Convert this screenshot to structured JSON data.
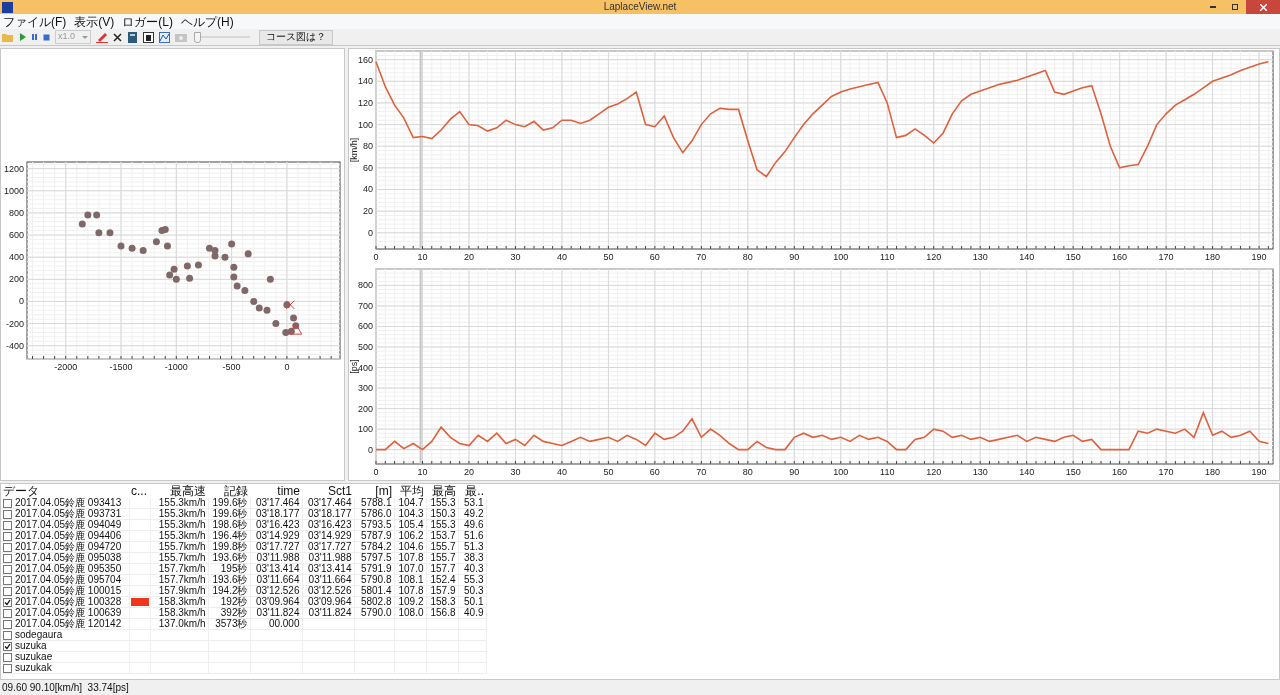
{
  "window": {
    "title": "LaplaceView.net"
  },
  "menu": [
    "ファイル(F)",
    "表示(V)",
    "ロガー(L)",
    "ヘルプ(H)"
  ],
  "toolbar": {
    "speed_select": {
      "value": "x1.0",
      "disabled": true
    },
    "camera_disabled": true,
    "slider": {
      "level": 0
    },
    "course_button": "コース図は？"
  },
  "track_map": {
    "chart_data": {
      "type": "scatter",
      "grid": true,
      "xlim": [
        -2350,
        480
      ],
      "ylim": [
        -520,
        1260
      ],
      "xticks": [
        -2000,
        -1500,
        -1000,
        -500,
        0
      ],
      "yticks": [
        -400,
        -200,
        0,
        200,
        400,
        600,
        800,
        1000,
        1200
      ],
      "x": [
        -1850,
        -1800,
        -1720,
        -1700,
        -1600,
        -1500,
        -1400,
        -1300,
        -1180,
        -1130,
        -1100,
        -1080,
        -1060,
        -1020,
        -1000,
        -900,
        -880,
        -800,
        -700,
        -650,
        -650,
        -560,
        -500,
        -480,
        -480,
        -450,
        -380,
        -350,
        -300,
        -250,
        -180,
        -150,
        -100,
        -10,
        0,
        40,
        60,
        80
      ],
      "series": [
        {
          "color": "#806868",
          "values": [
            700,
            780,
            780,
            620,
            620,
            500,
            480,
            460,
            540,
            640,
            650,
            500,
            240,
            290,
            200,
            320,
            210,
            330,
            480,
            410,
            460,
            400,
            520,
            220,
            310,
            140,
            100,
            430,
            0,
            -60,
            -80,
            200,
            -200,
            -280,
            -30,
            -270,
            -150,
            -220
          ]
        }
      ]
    }
  },
  "speed_chart": {
    "chart_data": {
      "type": "line",
      "grid": true,
      "ylabel": "[km/h]",
      "xlim": [
        0,
        193
      ],
      "ylim": [
        -15,
        168
      ],
      "xticks": [
        0,
        10,
        20,
        30,
        40,
        50,
        60,
        70,
        80,
        90,
        100,
        110,
        120,
        130,
        140,
        150,
        160,
        170,
        180,
        190
      ],
      "yticks": [
        0,
        20,
        40,
        60,
        80,
        100,
        120,
        140,
        160
      ],
      "x": [
        0,
        2,
        4,
        6,
        8,
        10,
        12,
        14,
        16,
        18,
        20,
        22,
        24,
        26,
        28,
        30,
        32,
        34,
        36,
        38,
        40,
        42,
        44,
        46,
        48,
        50,
        52,
        54,
        56,
        58,
        60,
        62,
        64,
        66,
        68,
        70,
        72,
        74,
        76,
        78,
        80,
        82,
        84,
        86,
        88,
        90,
        92,
        94,
        96,
        98,
        100,
        102,
        104,
        106,
        108,
        110,
        112,
        114,
        116,
        118,
        120,
        122,
        124,
        126,
        128,
        130,
        132,
        134,
        136,
        138,
        140,
        142,
        144,
        146,
        148,
        150,
        152,
        154,
        156,
        158,
        160,
        162,
        164,
        166,
        168,
        170,
        172,
        174,
        176,
        178,
        180,
        182,
        184,
        186,
        188,
        190,
        192
      ],
      "series": [
        {
          "color": "#e0603c",
          "values": [
            158,
            135,
            118,
            106,
            88,
            89,
            87,
            95,
            105,
            112,
            100,
            99,
            94,
            97,
            104,
            100,
            98,
            103,
            95,
            97,
            104,
            104,
            101,
            104,
            110,
            116,
            119,
            124,
            130,
            100,
            98,
            108,
            88,
            74,
            85,
            100,
            110,
            115,
            114,
            114,
            85,
            58,
            52,
            65,
            75,
            88,
            100,
            110,
            118,
            126,
            130,
            133,
            135,
            137,
            139,
            120,
            88,
            90,
            96,
            90,
            83,
            92,
            110,
            122,
            128,
            131,
            134,
            137,
            139,
            141,
            144,
            147,
            150,
            130,
            128,
            131,
            134,
            136,
            110,
            80,
            60,
            62,
            63,
            80,
            100,
            110,
            118,
            123,
            128,
            134,
            140,
            143,
            146,
            150,
            153,
            156,
            158
          ]
        }
      ],
      "ref_lines": [
        {
          "axis": "x",
          "value": 9.6
        }
      ]
    }
  },
  "power_chart": {
    "chart_data": {
      "type": "line",
      "grid": true,
      "ylabel": "[ps]",
      "xlim": [
        0,
        193
      ],
      "ylim": [
        -70,
        880
      ],
      "xticks": [
        0,
        10,
        20,
        30,
        40,
        50,
        60,
        70,
        80,
        90,
        100,
        110,
        120,
        130,
        140,
        150,
        160,
        170,
        180,
        190
      ],
      "yticks": [
        0,
        100,
        200,
        300,
        400,
        500,
        600,
        700,
        800
      ],
      "x": [
        0,
        2,
        4,
        6,
        8,
        10,
        12,
        14,
        16,
        18,
        20,
        22,
        24,
        26,
        28,
        30,
        32,
        34,
        36,
        38,
        40,
        42,
        44,
        46,
        48,
        50,
        52,
        54,
        56,
        58,
        60,
        62,
        64,
        66,
        68,
        70,
        72,
        74,
        76,
        78,
        80,
        82,
        84,
        86,
        88,
        90,
        92,
        94,
        96,
        98,
        100,
        102,
        104,
        106,
        108,
        110,
        112,
        114,
        116,
        118,
        120,
        122,
        124,
        126,
        128,
        130,
        132,
        134,
        136,
        138,
        140,
        142,
        144,
        146,
        148,
        150,
        152,
        154,
        156,
        158,
        160,
        162,
        164,
        166,
        168,
        170,
        172,
        174,
        176,
        178,
        180,
        182,
        184,
        186,
        188,
        190,
        192
      ],
      "series": [
        {
          "color": "#e0603c",
          "values": [
            0,
            0,
            40,
            5,
            30,
            0,
            40,
            110,
            60,
            30,
            20,
            70,
            40,
            80,
            30,
            50,
            20,
            70,
            40,
            30,
            20,
            40,
            60,
            40,
            50,
            60,
            40,
            70,
            50,
            20,
            80,
            50,
            60,
            90,
            150,
            60,
            100,
            70,
            30,
            0,
            0,
            40,
            10,
            0,
            0,
            60,
            80,
            60,
            70,
            50,
            60,
            40,
            70,
            50,
            60,
            40,
            0,
            0,
            50,
            60,
            100,
            90,
            60,
            70,
            50,
            60,
            40,
            50,
            60,
            70,
            40,
            60,
            50,
            40,
            60,
            70,
            40,
            50,
            0,
            0,
            0,
            0,
            90,
            80,
            100,
            90,
            80,
            100,
            60,
            180,
            70,
            90,
            60,
            70,
            90,
            40,
            30
          ]
        }
      ],
      "ref_lines": [
        {
          "axis": "x",
          "value": 9.6
        }
      ]
    }
  },
  "table": {
    "columns": [
      "データ",
      "c...",
      "最高速",
      "記録",
      "time",
      "Sct1",
      "[m]",
      "平均",
      "最高",
      "最.."
    ],
    "rows": [
      {
        "name": "2017.04.05鈴鹿 093413",
        "checked": false,
        "cells": [
          "155.3km/h",
          "199.6秒",
          "03'17.464",
          "03'17.464",
          "5788.1",
          "104.7",
          "155.3",
          "53.1"
        ]
      },
      {
        "name": "2017.04.05鈴鹿 093731",
        "checked": false,
        "cells": [
          "155.3km/h",
          "199.6秒",
          "03'18.177",
          "03'18.177",
          "5786.0",
          "104.3",
          "150.3",
          "49.2"
        ]
      },
      {
        "name": "2017.04.05鈴鹿 094049",
        "checked": false,
        "cells": [
          "155.3km/h",
          "198.6秒",
          "03'16.423",
          "03'16.423",
          "5793.5",
          "105.4",
          "155.3",
          "49.6"
        ]
      },
      {
        "name": "2017.04.05鈴鹿 094406",
        "checked": false,
        "cells": [
          "155.3km/h",
          "196.4秒",
          "03'14.929",
          "03'14.929",
          "5787.9",
          "106.2",
          "153.7",
          "51.6"
        ]
      },
      {
        "name": "2017.04.05鈴鹿 094720",
        "checked": false,
        "cells": [
          "155.7km/h",
          "199.8秒",
          "03'17.727",
          "03'17.727",
          "5784.2",
          "104.6",
          "155.7",
          "51.3"
        ]
      },
      {
        "name": "2017.04.05鈴鹿 095038",
        "checked": false,
        "cells": [
          "155.7km/h",
          "193.6秒",
          "03'11.988",
          "03'11.988",
          "5797.5",
          "107.8",
          "155.7",
          "38.3"
        ]
      },
      {
        "name": "2017.04.05鈴鹿 095350",
        "checked": false,
        "cells": [
          "157.7km/h",
          "195秒",
          "03'13.414",
          "03'13.414",
          "5791.9",
          "107.0",
          "157.7",
          "40.3"
        ]
      },
      {
        "name": "2017.04.05鈴鹿 095704",
        "checked": false,
        "cells": [
          "157.7km/h",
          "193.6秒",
          "03'11.664",
          "03'11.664",
          "5790.8",
          "108.1",
          "152.4",
          "55.3"
        ]
      },
      {
        "name": "2017.04.05鈴鹿 100015",
        "checked": false,
        "cells": [
          "157.9km/h",
          "194.2秒",
          "03'12.526",
          "03'12.526",
          "5801.4",
          "107.8",
          "157.9",
          "50.3"
        ]
      },
      {
        "name": "2017.04.05鈴鹿 100328",
        "checked": true,
        "color": "#f0361c",
        "cells": [
          "158.3km/h",
          "192秒",
          "03'09.964",
          "03'09.964",
          "5802.8",
          "109.2",
          "158.3",
          "50.1"
        ]
      },
      {
        "name": "2017.04.05鈴鹿 100639",
        "checked": false,
        "cells": [
          "158.3km/h",
          "392秒",
          "03'11.824",
          "03'11.824",
          "5790.0",
          "108.0",
          "156.8",
          "40.9"
        ]
      },
      {
        "name": "2017.04.05鈴鹿 120142",
        "checked": false,
        "cells": [
          "137.0km/h",
          "3573秒",
          "00.000"
        ]
      },
      {
        "name": "sodegaura",
        "checked": false
      },
      {
        "name": "suzuka",
        "checked": true
      },
      {
        "name": "suzukae",
        "checked": false
      },
      {
        "name": "suzukak",
        "checked": false
      }
    ]
  },
  "status_bar": "09.60 90.10[km/h]  33.74[ps]"
}
